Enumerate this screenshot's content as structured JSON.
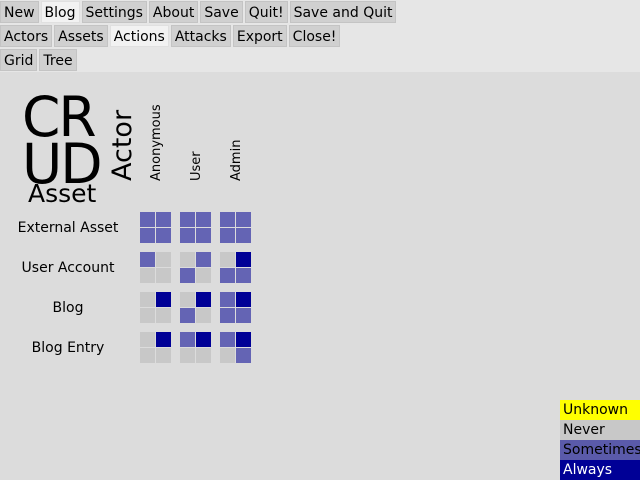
{
  "toolbar_main": [
    "New",
    "Blog",
    "Settings",
    "About",
    "Save",
    "Quit!",
    "Save and Quit"
  ],
  "toolbar_sub": [
    "Actors",
    "Assets",
    "Actions",
    "Attacks",
    "Export",
    "Close!"
  ],
  "toolbar_view": [
    "Grid",
    "Tree"
  ],
  "active": {
    "main": "Blog",
    "sub": "Actions"
  },
  "matrix": {
    "crud_line1": "CR",
    "crud_line2": "UD",
    "asset_header": "Asset",
    "actor_header": "Actor",
    "actors": [
      "Anonymous",
      "User",
      "Admin"
    ],
    "assets": [
      "External Asset",
      "User Account",
      "Blog",
      "Blog Entry"
    ],
    "cells": [
      [
        [
          "S",
          "S",
          "S",
          "S"
        ],
        [
          "S",
          "S",
          "S",
          "S"
        ],
        [
          "S",
          "S",
          "S",
          "S"
        ]
      ],
      [
        [
          "S",
          "N",
          "N",
          "N"
        ],
        [
          "N",
          "S",
          "S",
          "N"
        ],
        [
          "N",
          "A",
          "S",
          "S"
        ]
      ],
      [
        [
          "N",
          "A",
          "N",
          "N"
        ],
        [
          "N",
          "A",
          "S",
          "N"
        ],
        [
          "S",
          "A",
          "S",
          "S"
        ]
      ],
      [
        [
          "N",
          "A",
          "N",
          "N"
        ],
        [
          "S",
          "A",
          "N",
          "N"
        ],
        [
          "S",
          "A",
          "N",
          "S"
        ]
      ]
    ]
  },
  "legend": [
    {
      "label": "Unknown",
      "bg": "#ffff00",
      "fg": "#000000"
    },
    {
      "label": "Never",
      "bg": "#c8c8c8",
      "fg": "#000000"
    },
    {
      "label": "Sometimes",
      "bg": "#5a5aaa",
      "fg": "#000000"
    },
    {
      "label": "Always",
      "bg": "#000096",
      "fg": "#ffffff"
    }
  ],
  "colors": {
    "U": "#ffff00",
    "N": "#c8c8c8",
    "S": "#6464b4",
    "A": "#000096"
  }
}
